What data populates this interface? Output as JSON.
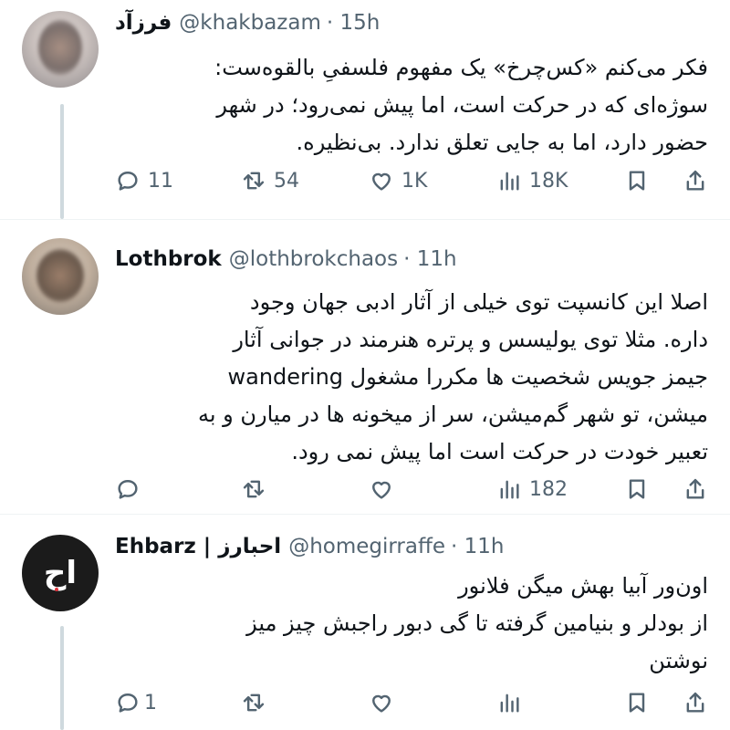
{
  "tweets": [
    {
      "name": "فرزآد",
      "handle": "@khakbazam",
      "time": "· 15h",
      "lines": [
        "فکر می‌کنم «کس‌چرخ» یک مفهوم فلسفیِ بالقوه‌ست:",
        "سوژه‌ای که در حرکت است، اما پیش نمی‌رود؛ در شهر",
        "حضور دارد، اما به جایی تعلق ندارد. بی‌نظیره."
      ],
      "actions": {
        "reply": "11",
        "retweet": "54",
        "like": "1K",
        "views": "18K"
      },
      "avatar_icon": "blurred-profile-photo"
    },
    {
      "name": "Lothbrok",
      "handle": "@lothbrokchaos",
      "time": "· 11h",
      "lines": [
        "اصلا این کانسپت توی خیلی از آثار ادبی جهان وجود",
        "داره. مثلا توی یولیسس و پرتره هنرمند در جوانی آثار",
        "جیمز جویس شخصیت ها مکررا مشغول wandering",
        "میشن، تو شهر گم‌میشن، سر از میخونه ها در میارن و به",
        "تعبیر خودت در حرکت است اما پیش نمی رود."
      ],
      "actions": {
        "reply": "",
        "retweet": "",
        "like": "",
        "views": "182"
      },
      "avatar_icon": "blurred-profile-photo"
    },
    {
      "name": "Ehbarz | احبارز",
      "handle": "@homegirraffe",
      "time": "· 11h",
      "lines": [
        "اون‌ور آبیا بهش میگن فلانور",
        "از بودلر و بنیامین گرفته تا گی دبور راجبش چیز میز",
        "نوشتن"
      ],
      "actions": {
        "reply": "1",
        "retweet": "",
        "like": "",
        "views": ""
      },
      "avatar_text": "اح"
    }
  ],
  "colors": {
    "text": "#0f1419",
    "secondary": "#536471",
    "thread_line": "#cfd9de",
    "divider": "#eff3f4"
  }
}
